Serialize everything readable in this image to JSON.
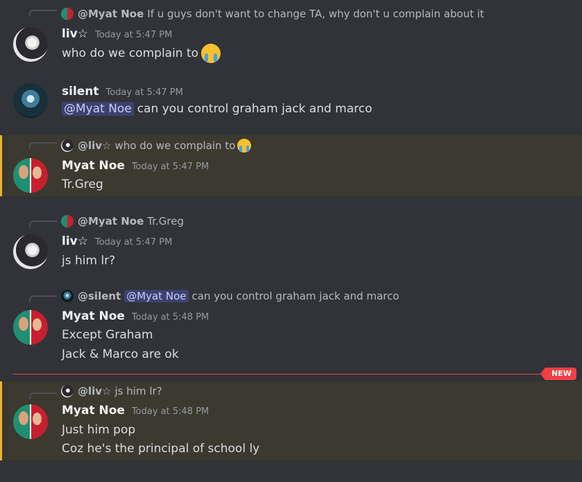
{
  "messages": [
    {
      "reply": {
        "author": "@Myat Noe",
        "text": "If u guys don't want to change TA, why don't u complain about it"
      },
      "author": "liv☆",
      "time": "Today at 5:47 PM",
      "lines": [
        "who do we complain to"
      ],
      "emoji": "loudly-crying-face-emoji"
    },
    {
      "author": "silent",
      "time": "Today at 5:47 PM",
      "mention": "@Myat Noe",
      "lines": [
        "can you control graham jack and marco"
      ]
    },
    {
      "reply": {
        "author": "@liv☆",
        "text": "who do we complain to",
        "emoji": "loudly-crying-face-emoji"
      },
      "author": "Myat Noe",
      "time": "Today at 5:47 PM",
      "lines": [
        "Tr.Greg"
      ],
      "highlighted": true
    },
    {
      "reply": {
        "author": "@Myat Noe",
        "text": "Tr.Greg"
      },
      "author": "liv☆",
      "time": "Today at 5:47 PM",
      "lines": [
        "js him lr?"
      ]
    },
    {
      "reply": {
        "author": "@silent",
        "mention": "@Myat Noe",
        "text": "can you control graham jack and marco"
      },
      "author": "Myat Noe",
      "time": "Today at 5:48 PM",
      "lines": [
        "Except Graham",
        "Jack & Marco are ok"
      ]
    },
    {
      "reply": {
        "author": "@liv☆",
        "text": "js him lr?"
      },
      "author": "Myat Noe",
      "time": "Today at 5:48 PM",
      "lines": [
        "Just him pop",
        "Coz he's the principal of school ly"
      ],
      "highlighted": true
    }
  ],
  "divider": {
    "label": "NEW"
  },
  "colors": {
    "background": "#313338",
    "mention_highlight_bg": "#3c3930",
    "mention_highlight_border": "#f0b232",
    "mention_pill_bg": "#3c4270",
    "new_divider": "#f23f43"
  }
}
